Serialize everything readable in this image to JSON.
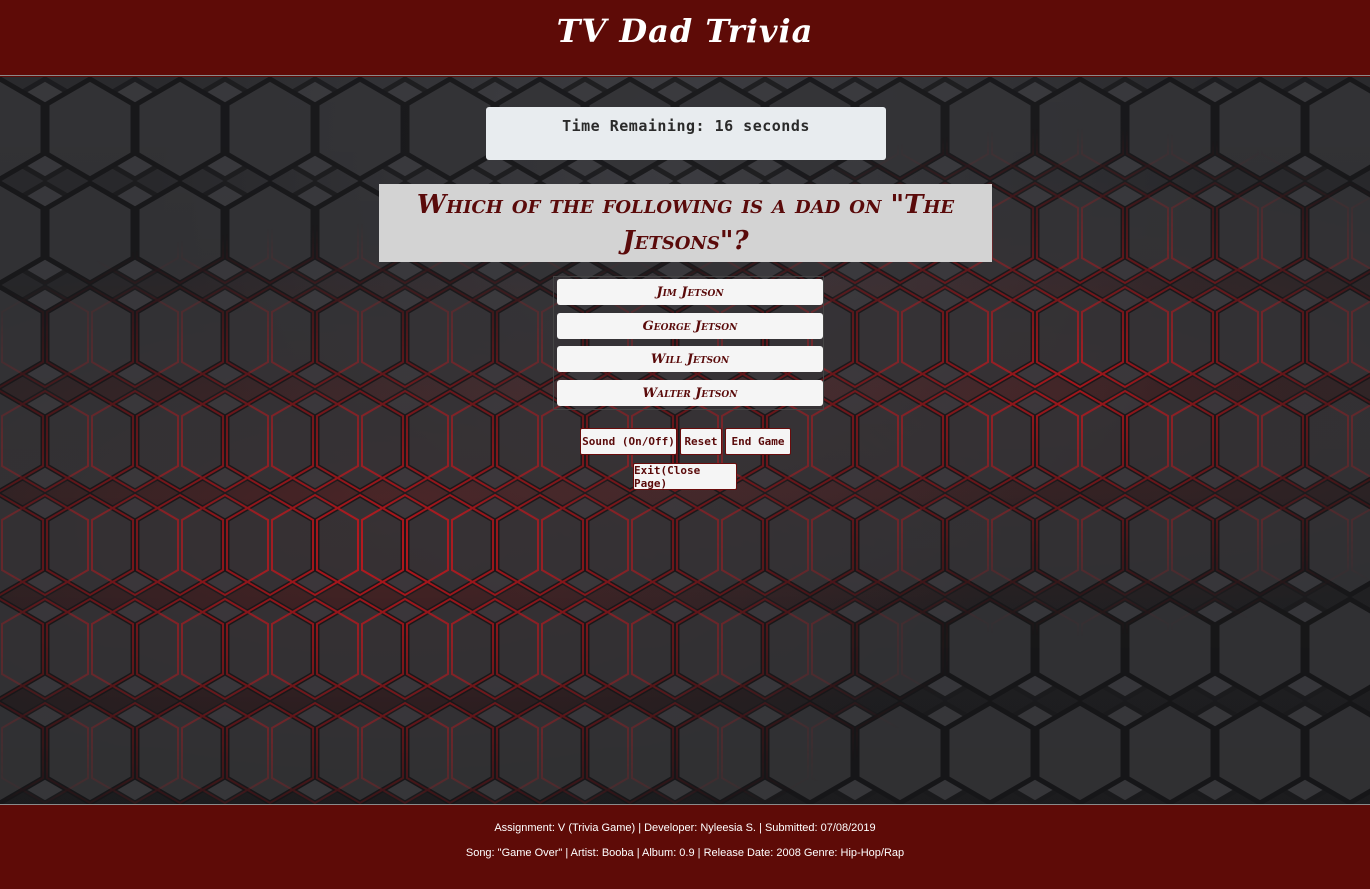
{
  "header": {
    "title": "TV Dad Trivia"
  },
  "timer": {
    "text": "Time Remaining: 16 seconds"
  },
  "question": {
    "text": "Which of the following is a dad on \"The Jetsons\"?"
  },
  "answers": [
    "Jim Jetson",
    "George Jetson",
    "Will Jetson",
    "Walter Jetson"
  ],
  "controls": {
    "sound": "Sound (On/Off)",
    "reset": "Reset",
    "end_game": "End Game",
    "exit": "Exit(Close Page)"
  },
  "footer": {
    "line1": "Assignment: V (Trivia Game) | Developer: Nyleesia S. | Submitted: 07/08/2019",
    "line2": "Song: \"Game Over\" | Artist: Booba | Album: 0.9 | Release Date: 2008 Genre: Hip-Hop/Rap"
  },
  "colors": {
    "header_bg": "#5e0b07",
    "accent_text": "#5a0a0a",
    "hex_glow": "#c8161c"
  }
}
